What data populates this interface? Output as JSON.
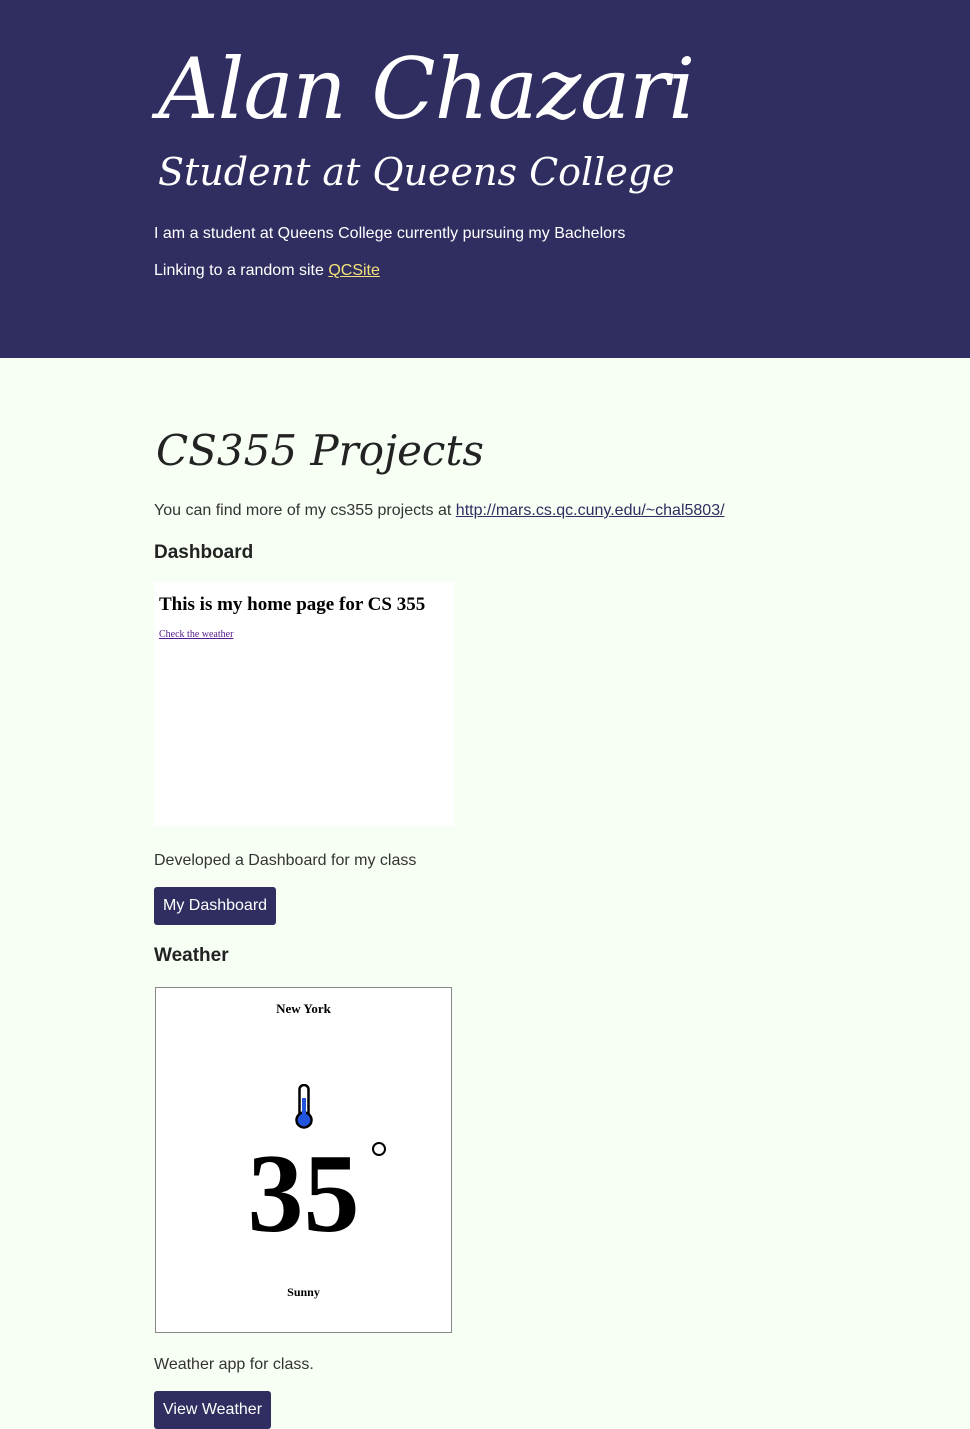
{
  "header": {
    "name": "Alan Chazari",
    "subtitle": "Student at Queens College",
    "bio": "I am a student at Queens College currently pursuing my Bachelors",
    "link_prefix": "Linking to a random site ",
    "link_label": "QCSite"
  },
  "projects": {
    "title": "CS355 Projects",
    "intro_prefix": "You can find more of my cs355 projects at ",
    "intro_link": "http://mars.cs.qc.cuny.edu/~chal5803/",
    "items": [
      {
        "title": "Dashboard",
        "preview_heading": "This is my home page for CS 355",
        "preview_link": "Check the weather",
        "description": "Developed a Dashboard for my class",
        "button": "My Dashboard"
      },
      {
        "title": "Weather",
        "preview_city": "New York",
        "preview_temp": "35",
        "preview_condition": "Sunny",
        "description": "Weather app for class.",
        "button": "View Weather"
      }
    ]
  },
  "colors": {
    "header_bg": "#302e60",
    "page_bg": "#f7fff5",
    "link_accent": "#f4e27a",
    "button_bg": "#302e60"
  },
  "icons": [
    "thermometer-icon",
    "degree-icon"
  ]
}
